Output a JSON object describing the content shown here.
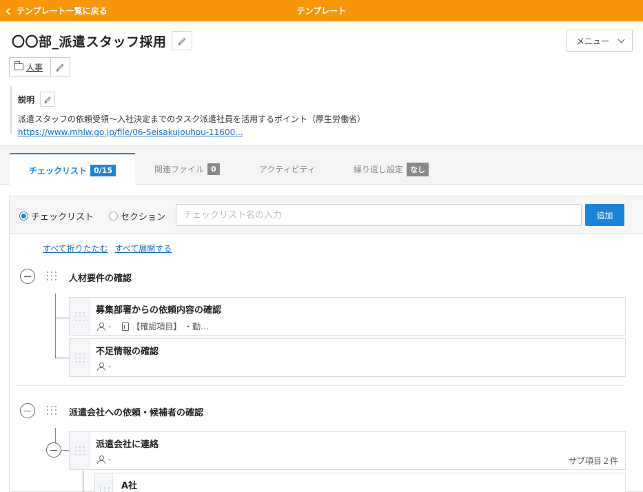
{
  "topbar": {
    "back_label": "テンプレート一覧に戻る",
    "title": "テンプレート"
  },
  "template": {
    "title": "〇〇部_派遣スタッフ採用"
  },
  "menu": {
    "label": "メニュー"
  },
  "category": {
    "label": "人事"
  },
  "description": {
    "heading": "説明",
    "text": "派遣スタッフの依頼受領〜入社決定までのタスク派遣社員を活用するポイント（厚生労働省）",
    "link": "https://www.mhlw.go.jp/file/06-Seisakujouhou-11600..."
  },
  "tabs": [
    {
      "label": "チェックリスト",
      "badge": "0/15"
    },
    {
      "label": "関連ファイル",
      "badge": "0"
    },
    {
      "label": "アクティビティ"
    },
    {
      "label": "繰り返し設定",
      "badge": "なし"
    }
  ],
  "add_form": {
    "radio_checklist": "チェックリスト",
    "radio_section": "セクション",
    "placeholder": "チェックリスト名の入力",
    "add_label": "追加"
  },
  "links": {
    "collapse_all": "すべて折りたたむ",
    "expand_all": "すべて展開する"
  },
  "sections": [
    {
      "title": "人材要件の確認",
      "items": [
        {
          "title": "募集部署からの依頼内容の確認",
          "assignee": "-",
          "note": "【確認項目】 ・勤…"
        },
        {
          "title": "不足情報の確認",
          "assignee": "-"
        }
      ]
    },
    {
      "title": "派遣会社への依頼・候補者の確認",
      "items": [
        {
          "title": "派遣会社に連絡",
          "assignee": "-",
          "subcount": "サブ項目２件"
        },
        {
          "title": "A社"
        }
      ]
    }
  ],
  "colors": {
    "accent": "#1a85d8",
    "topbar": "#f8960a"
  }
}
